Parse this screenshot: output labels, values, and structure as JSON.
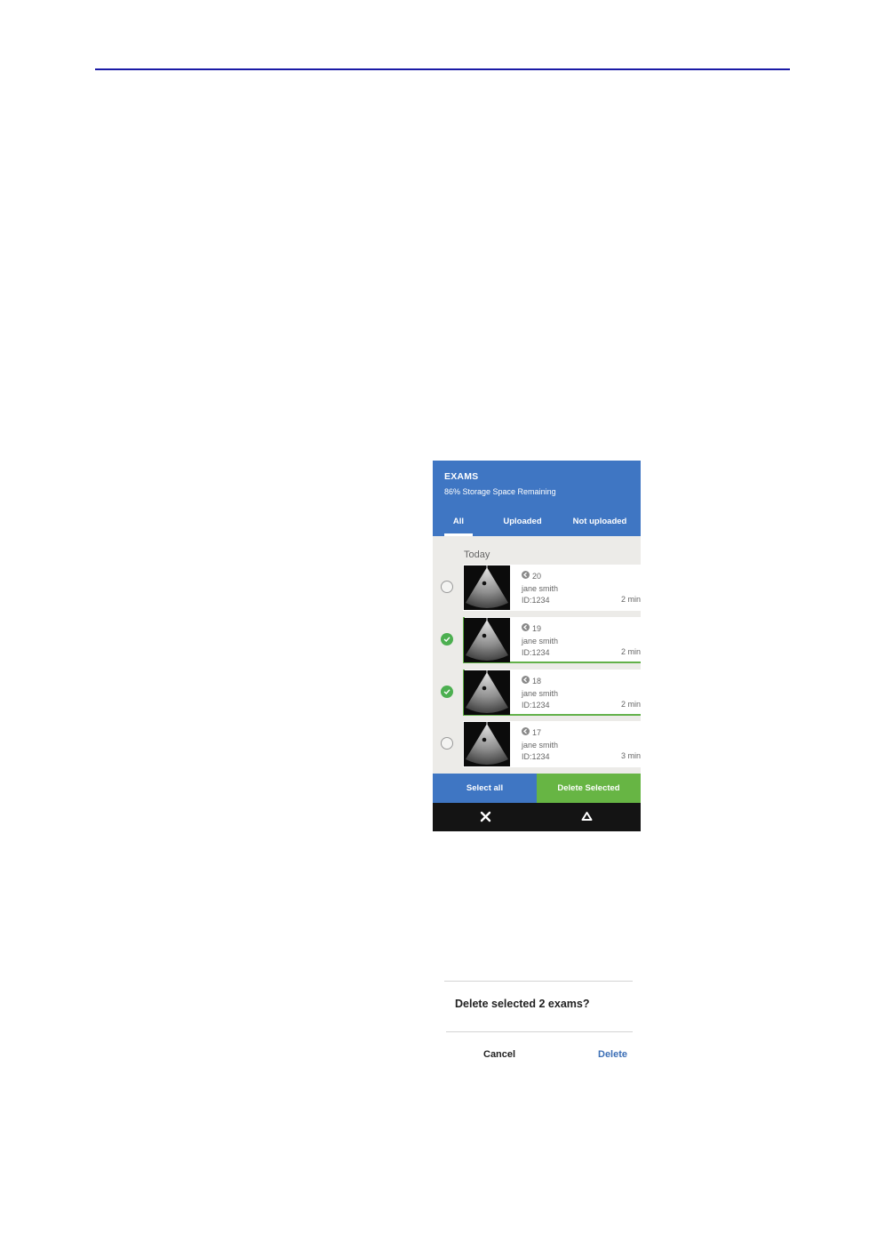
{
  "header": {
    "title": "EXAMS",
    "storage": "86% Storage Space Remaining"
  },
  "tabs": [
    {
      "label": "All",
      "active": true
    },
    {
      "label": "Uploaded",
      "active": false
    },
    {
      "label": "Not uploaded",
      "active": false
    }
  ],
  "section_label": "Today",
  "exams": [
    {
      "number": "20",
      "name": "jane smith",
      "id": "ID:1234",
      "duration": "2 min",
      "selected": false
    },
    {
      "number": "19",
      "name": "jane smith",
      "id": "ID:1234",
      "duration": "2 min",
      "selected": true
    },
    {
      "number": "18",
      "name": "jane smith",
      "id": "ID:1234",
      "duration": "2 min",
      "selected": true
    },
    {
      "number": "17",
      "name": "jane smith",
      "id": "ID:1234",
      "duration": "3 min",
      "selected": false
    }
  ],
  "actions": {
    "select_all": "Select all",
    "delete_selected": "Delete Selected"
  },
  "navbar": {
    "icons": [
      "close-icon",
      "eject-icon"
    ]
  },
  "dialog": {
    "question": "Delete selected 2 exams?",
    "cancel": "Cancel",
    "delete": "Delete"
  },
  "colors": {
    "accent_blue": "#3f76c3",
    "accent_green": "#67b544",
    "rule_blue": "#1a1aa6"
  }
}
